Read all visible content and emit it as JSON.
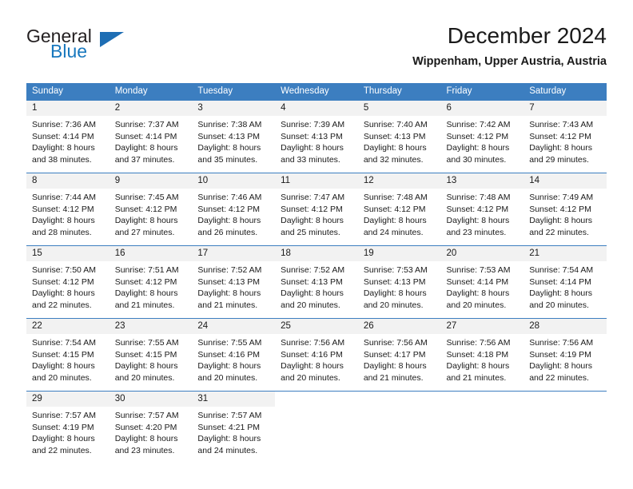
{
  "brand": {
    "name_part1": "General",
    "name_part2": "Blue",
    "flag_icon": "brand-flag-icon",
    "accent_color": "#1878be"
  },
  "header": {
    "title": "December 2024",
    "location": "Wippenham, Upper Austria, Austria"
  },
  "theme": {
    "header_row_bg": "#3c7ec0",
    "daynum_band_bg": "#f2f2f2",
    "grid_line": "#3c7ec0",
    "text": "#1a1a1a"
  },
  "weekday_headers": [
    "Sunday",
    "Monday",
    "Tuesday",
    "Wednesday",
    "Thursday",
    "Friday",
    "Saturday"
  ],
  "weeks": [
    [
      {
        "day": "1",
        "sunrise": "Sunrise: 7:36 AM",
        "sunset": "Sunset: 4:14 PM",
        "daylight1": "Daylight: 8 hours",
        "daylight2": "and 38 minutes."
      },
      {
        "day": "2",
        "sunrise": "Sunrise: 7:37 AM",
        "sunset": "Sunset: 4:14 PM",
        "daylight1": "Daylight: 8 hours",
        "daylight2": "and 37 minutes."
      },
      {
        "day": "3",
        "sunrise": "Sunrise: 7:38 AM",
        "sunset": "Sunset: 4:13 PM",
        "daylight1": "Daylight: 8 hours",
        "daylight2": "and 35 minutes."
      },
      {
        "day": "4",
        "sunrise": "Sunrise: 7:39 AM",
        "sunset": "Sunset: 4:13 PM",
        "daylight1": "Daylight: 8 hours",
        "daylight2": "and 33 minutes."
      },
      {
        "day": "5",
        "sunrise": "Sunrise: 7:40 AM",
        "sunset": "Sunset: 4:13 PM",
        "daylight1": "Daylight: 8 hours",
        "daylight2": "and 32 minutes."
      },
      {
        "day": "6",
        "sunrise": "Sunrise: 7:42 AM",
        "sunset": "Sunset: 4:12 PM",
        "daylight1": "Daylight: 8 hours",
        "daylight2": "and 30 minutes."
      },
      {
        "day": "7",
        "sunrise": "Sunrise: 7:43 AM",
        "sunset": "Sunset: 4:12 PM",
        "daylight1": "Daylight: 8 hours",
        "daylight2": "and 29 minutes."
      }
    ],
    [
      {
        "day": "8",
        "sunrise": "Sunrise: 7:44 AM",
        "sunset": "Sunset: 4:12 PM",
        "daylight1": "Daylight: 8 hours",
        "daylight2": "and 28 minutes."
      },
      {
        "day": "9",
        "sunrise": "Sunrise: 7:45 AM",
        "sunset": "Sunset: 4:12 PM",
        "daylight1": "Daylight: 8 hours",
        "daylight2": "and 27 minutes."
      },
      {
        "day": "10",
        "sunrise": "Sunrise: 7:46 AM",
        "sunset": "Sunset: 4:12 PM",
        "daylight1": "Daylight: 8 hours",
        "daylight2": "and 26 minutes."
      },
      {
        "day": "11",
        "sunrise": "Sunrise: 7:47 AM",
        "sunset": "Sunset: 4:12 PM",
        "daylight1": "Daylight: 8 hours",
        "daylight2": "and 25 minutes."
      },
      {
        "day": "12",
        "sunrise": "Sunrise: 7:48 AM",
        "sunset": "Sunset: 4:12 PM",
        "daylight1": "Daylight: 8 hours",
        "daylight2": "and 24 minutes."
      },
      {
        "day": "13",
        "sunrise": "Sunrise: 7:48 AM",
        "sunset": "Sunset: 4:12 PM",
        "daylight1": "Daylight: 8 hours",
        "daylight2": "and 23 minutes."
      },
      {
        "day": "14",
        "sunrise": "Sunrise: 7:49 AM",
        "sunset": "Sunset: 4:12 PM",
        "daylight1": "Daylight: 8 hours",
        "daylight2": "and 22 minutes."
      }
    ],
    [
      {
        "day": "15",
        "sunrise": "Sunrise: 7:50 AM",
        "sunset": "Sunset: 4:12 PM",
        "daylight1": "Daylight: 8 hours",
        "daylight2": "and 22 minutes."
      },
      {
        "day": "16",
        "sunrise": "Sunrise: 7:51 AM",
        "sunset": "Sunset: 4:12 PM",
        "daylight1": "Daylight: 8 hours",
        "daylight2": "and 21 minutes."
      },
      {
        "day": "17",
        "sunrise": "Sunrise: 7:52 AM",
        "sunset": "Sunset: 4:13 PM",
        "daylight1": "Daylight: 8 hours",
        "daylight2": "and 21 minutes."
      },
      {
        "day": "18",
        "sunrise": "Sunrise: 7:52 AM",
        "sunset": "Sunset: 4:13 PM",
        "daylight1": "Daylight: 8 hours",
        "daylight2": "and 20 minutes."
      },
      {
        "day": "19",
        "sunrise": "Sunrise: 7:53 AM",
        "sunset": "Sunset: 4:13 PM",
        "daylight1": "Daylight: 8 hours",
        "daylight2": "and 20 minutes."
      },
      {
        "day": "20",
        "sunrise": "Sunrise: 7:53 AM",
        "sunset": "Sunset: 4:14 PM",
        "daylight1": "Daylight: 8 hours",
        "daylight2": "and 20 minutes."
      },
      {
        "day": "21",
        "sunrise": "Sunrise: 7:54 AM",
        "sunset": "Sunset: 4:14 PM",
        "daylight1": "Daylight: 8 hours",
        "daylight2": "and 20 minutes."
      }
    ],
    [
      {
        "day": "22",
        "sunrise": "Sunrise: 7:54 AM",
        "sunset": "Sunset: 4:15 PM",
        "daylight1": "Daylight: 8 hours",
        "daylight2": "and 20 minutes."
      },
      {
        "day": "23",
        "sunrise": "Sunrise: 7:55 AM",
        "sunset": "Sunset: 4:15 PM",
        "daylight1": "Daylight: 8 hours",
        "daylight2": "and 20 minutes."
      },
      {
        "day": "24",
        "sunrise": "Sunrise: 7:55 AM",
        "sunset": "Sunset: 4:16 PM",
        "daylight1": "Daylight: 8 hours",
        "daylight2": "and 20 minutes."
      },
      {
        "day": "25",
        "sunrise": "Sunrise: 7:56 AM",
        "sunset": "Sunset: 4:16 PM",
        "daylight1": "Daylight: 8 hours",
        "daylight2": "and 20 minutes."
      },
      {
        "day": "26",
        "sunrise": "Sunrise: 7:56 AM",
        "sunset": "Sunset: 4:17 PM",
        "daylight1": "Daylight: 8 hours",
        "daylight2": "and 21 minutes."
      },
      {
        "day": "27",
        "sunrise": "Sunrise: 7:56 AM",
        "sunset": "Sunset: 4:18 PM",
        "daylight1": "Daylight: 8 hours",
        "daylight2": "and 21 minutes."
      },
      {
        "day": "28",
        "sunrise": "Sunrise: 7:56 AM",
        "sunset": "Sunset: 4:19 PM",
        "daylight1": "Daylight: 8 hours",
        "daylight2": "and 22 minutes."
      }
    ],
    [
      {
        "day": "29",
        "sunrise": "Sunrise: 7:57 AM",
        "sunset": "Sunset: 4:19 PM",
        "daylight1": "Daylight: 8 hours",
        "daylight2": "and 22 minutes."
      },
      {
        "day": "30",
        "sunrise": "Sunrise: 7:57 AM",
        "sunset": "Sunset: 4:20 PM",
        "daylight1": "Daylight: 8 hours",
        "daylight2": "and 23 minutes."
      },
      {
        "day": "31",
        "sunrise": "Sunrise: 7:57 AM",
        "sunset": "Sunset: 4:21 PM",
        "daylight1": "Daylight: 8 hours",
        "daylight2": "and 24 minutes."
      },
      {
        "day": "",
        "sunrise": "",
        "sunset": "",
        "daylight1": "",
        "daylight2": ""
      },
      {
        "day": "",
        "sunrise": "",
        "sunset": "",
        "daylight1": "",
        "daylight2": ""
      },
      {
        "day": "",
        "sunrise": "",
        "sunset": "",
        "daylight1": "",
        "daylight2": ""
      },
      {
        "day": "",
        "sunrise": "",
        "sunset": "",
        "daylight1": "",
        "daylight2": ""
      }
    ]
  ]
}
